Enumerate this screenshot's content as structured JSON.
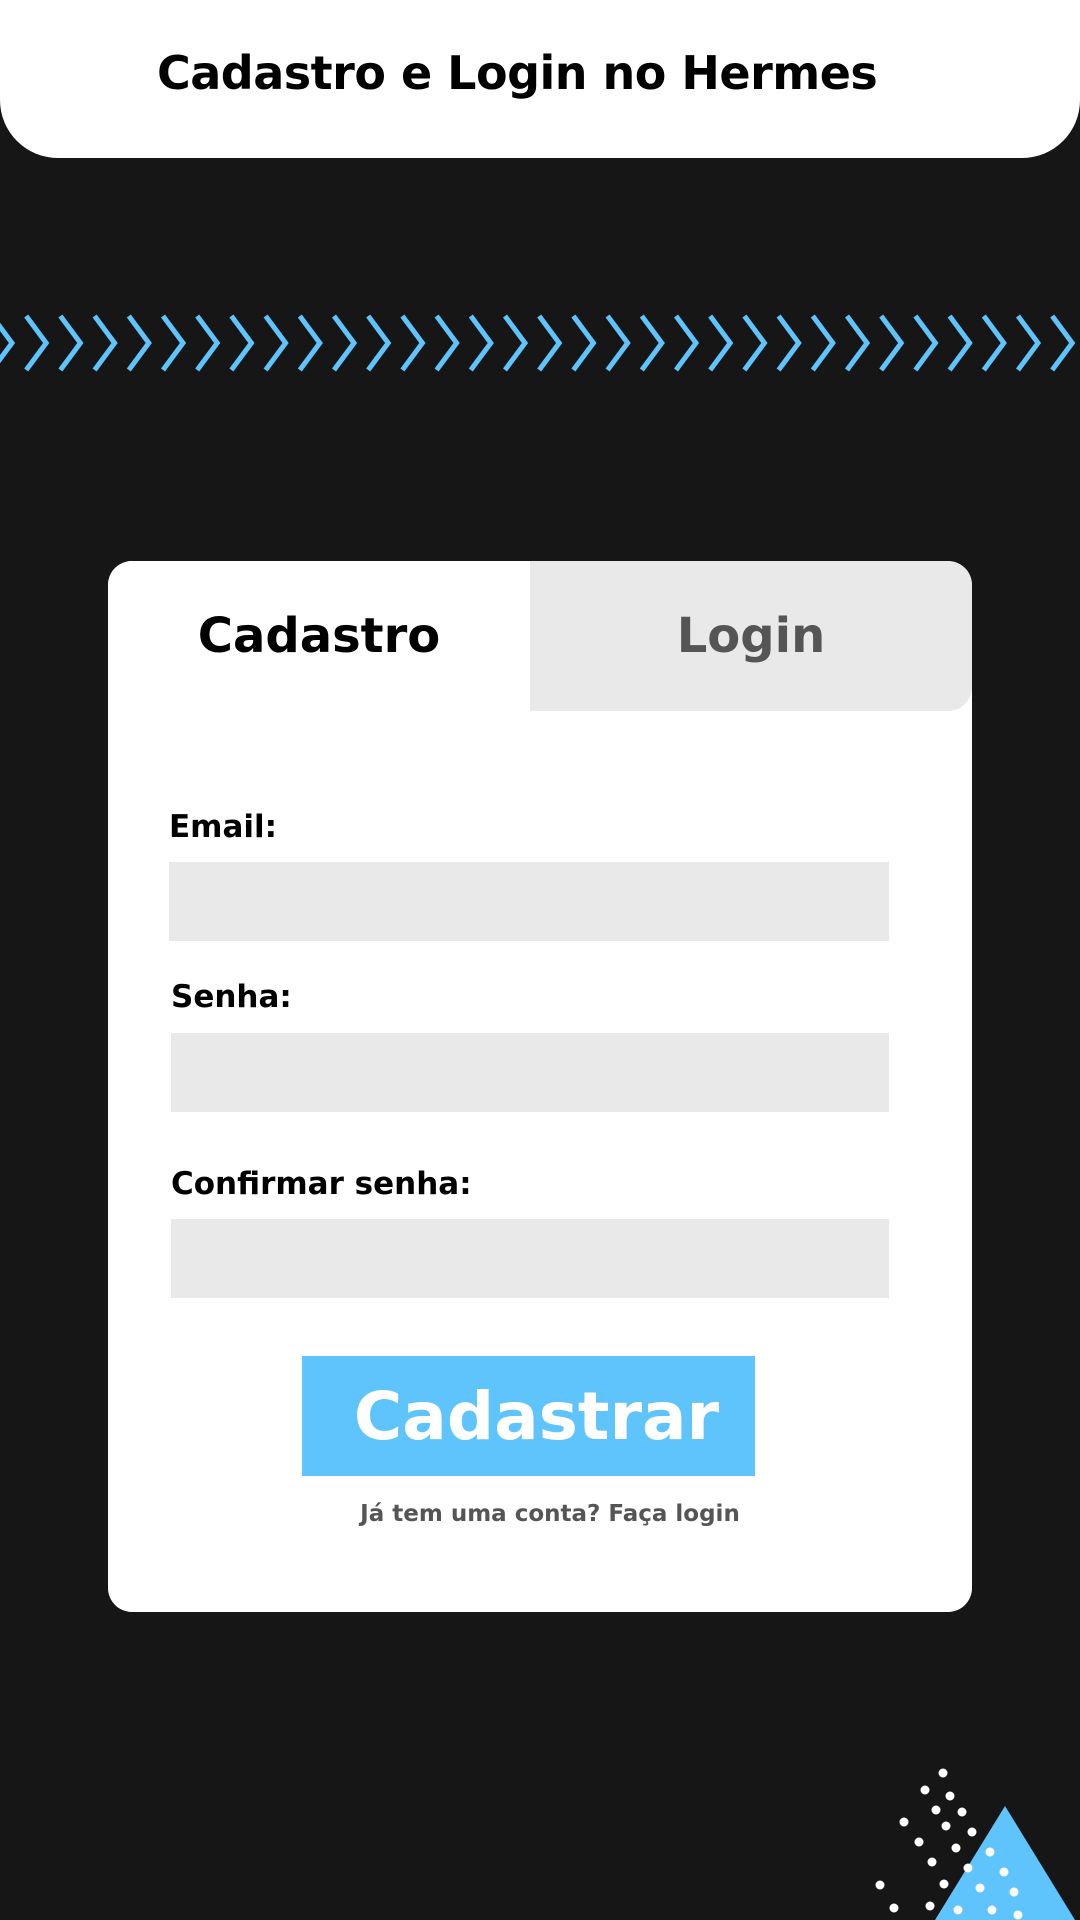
{
  "header": {
    "title": "Cadastro e Login no Hermes"
  },
  "tabs": [
    {
      "label": "Cadastro",
      "active": true
    },
    {
      "label": "Login",
      "active": false
    }
  ],
  "form": {
    "email": {
      "label": "Email:",
      "value": "",
      "placeholder": ""
    },
    "senha": {
      "label": "Senha:",
      "value": "",
      "placeholder": ""
    },
    "confirmar": {
      "label": "Confirmar senha:",
      "value": "",
      "placeholder": ""
    },
    "submit_label": "Cadastrar",
    "login_link": "Já tem uma conta? Faça login"
  },
  "decor": {
    "chevron_band_icon": "chevron-right-icon",
    "corner_icon": "triangle-dots-icon"
  },
  "colors": {
    "background": "#161616",
    "accent": "#5fc3fc",
    "input_bg": "#e9e9e9",
    "muted_text": "#555555"
  }
}
